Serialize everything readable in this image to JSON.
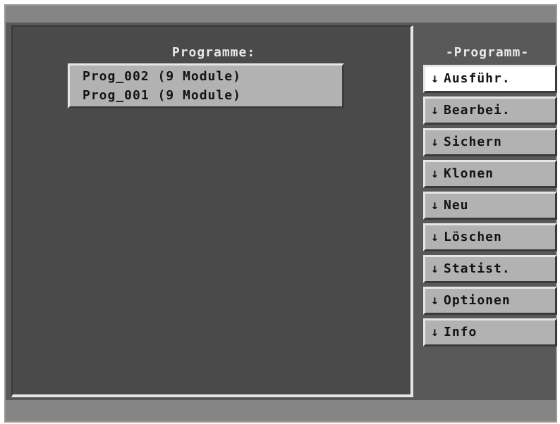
{
  "main": {
    "title": "Programme:",
    "programs": [
      "Prog_002 (9 Module)",
      "Prog_001 (9 Module)"
    ]
  },
  "side": {
    "title": "-Programm-",
    "arrow": "↓",
    "buttons": [
      {
        "label": "Ausführ.",
        "active": true
      },
      {
        "label": "Bearbei."
      },
      {
        "label": "Sichern"
      },
      {
        "label": "Klonen"
      },
      {
        "label": "Neu"
      },
      {
        "label": "Löschen"
      },
      {
        "label": "Statist."
      },
      {
        "label": "Optionen"
      },
      {
        "label": "Info"
      }
    ]
  }
}
